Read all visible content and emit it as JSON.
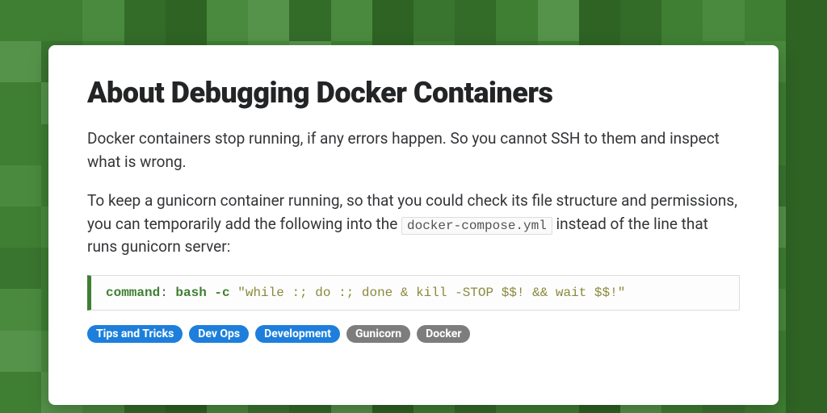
{
  "title": "About Debugging Docker Containers",
  "para1": "Docker containers stop running, if any errors happen. So you cannot SSH to them and inspect what is wrong.",
  "para2_a": "To keep a gunicorn container running, so that you could check its file structure and permissions, you can temporarily add the following into the ",
  "para2_code": "docker-compose.yml",
  "para2_b": " instead of the line that runs gunicorn server:",
  "code": {
    "key": "command",
    "colon": ": ",
    "cmd": "bash -c",
    "str": " \"while :; do :; done & kill -STOP $$! && wait $$!\""
  },
  "tags": [
    {
      "label": "Tips and Tricks",
      "variant": "blue"
    },
    {
      "label": "Dev Ops",
      "variant": "blue"
    },
    {
      "label": "Development",
      "variant": "blue"
    },
    {
      "label": "Gunicorn",
      "variant": "gray"
    },
    {
      "label": "Docker",
      "variant": "gray"
    }
  ]
}
